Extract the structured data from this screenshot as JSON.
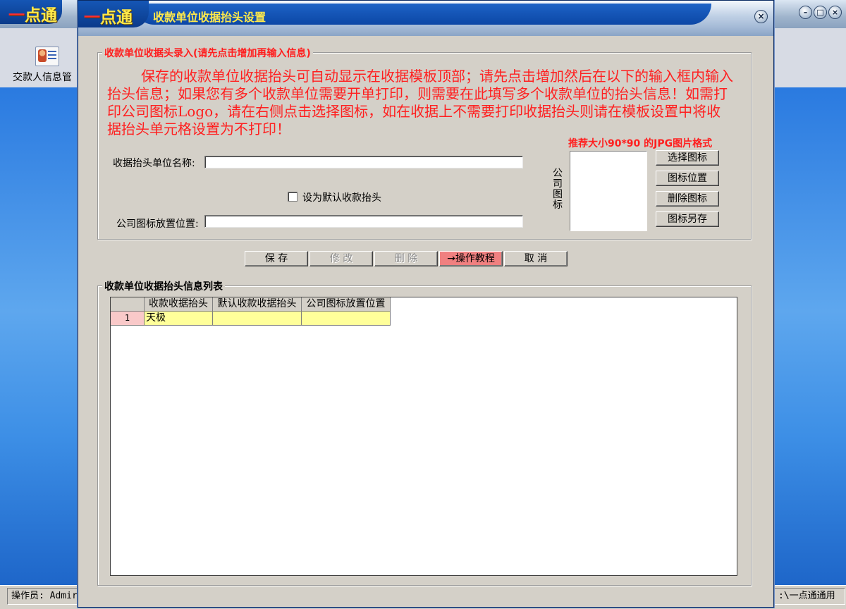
{
  "background": {
    "brand": {
      "red": "一",
      "yellow": "点通"
    },
    "window_controls": [
      "min-icon",
      "restore-icon",
      "close-icon"
    ],
    "toolbar": {
      "item_label": "交款人信息管",
      "item_icon": "person-card-icon"
    },
    "status": {
      "left": "操作员: Admir",
      "right": ":\\一点通通用"
    }
  },
  "dialog": {
    "brand": {
      "red": "一",
      "yellow": "点通"
    },
    "title": "收款单位收据抬头设置",
    "close_icon": "close-icon",
    "entry_group": {
      "legend": "收款单位收据头录入(请先点击增加再输入信息)",
      "intro": "保存的收款单位收据抬头可自动显示在收据模板顶部；请先点击增加然后在以下的输入框内输入抬头信息；如果您有多个收款单位需要开单打印，则需要在此填写多个收款单位的抬头信息！如需打印公司图标Logo，请在右侧点击选择图标，如在收据上不需要打印收据抬头则请在模板设置中将收据抬头单元格设置为不打印！",
      "name_label": "收据抬头单位名称:",
      "name_value": "",
      "default_checkbox_label": "设为默认收款抬头",
      "default_checked": false,
      "logo_pos_label": "公司图标放置位置:",
      "logo_pos_value": "",
      "logo_hint": "推荐大小90*90 的JPG图片格式",
      "logo_label": "公司图标",
      "logo_buttons": [
        "选择图标",
        "图标位置",
        "删除图标",
        "图标另存"
      ]
    },
    "actions": {
      "save": "保 存",
      "modify": "修 改",
      "delete": "删 除",
      "tutorial": "→操作教程",
      "cancel": "取 消"
    },
    "list_group": {
      "legend": "收款单位收据抬头信息列表",
      "columns": [
        "",
        "收款收据抬头",
        "默认收款收据抬头",
        "公司图标放置位置"
      ],
      "rows": [
        {
          "num": "1",
          "header": "天极",
          "default": "",
          "logo_pos": ""
        }
      ]
    },
    "colors": {
      "accent_red": "#ff1f1f",
      "brand_yellow": "#ffe94a",
      "row_yellow": "#ffff9a",
      "row_num_pink": "#f9c9c9"
    }
  }
}
